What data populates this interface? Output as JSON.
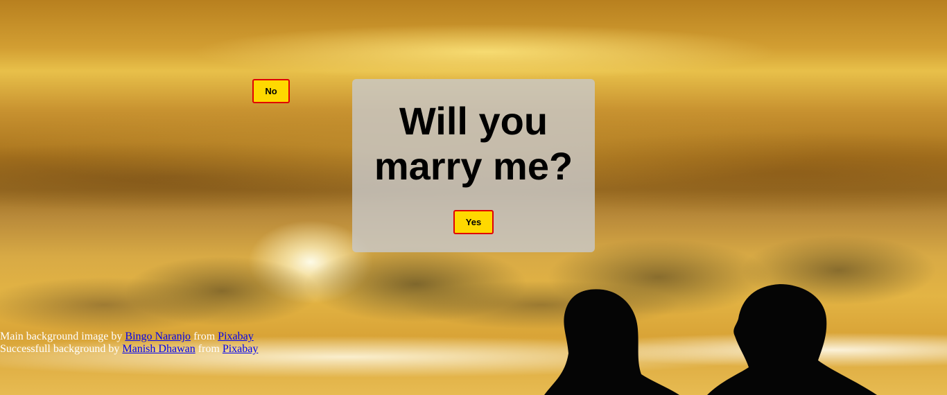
{
  "question": {
    "line1": "Will you",
    "line2": "marry me?"
  },
  "buttons": {
    "yes_label": "Yes",
    "no_label": "No"
  },
  "credits": {
    "line1": {
      "prefix": "Main background image by",
      "author": "Bingo Naranjo",
      "middle": "from",
      "source": "Pixabay"
    },
    "line2": {
      "prefix": "Successfull background by",
      "author": "Manish Dhawan",
      "middle": "from",
      "source": "Pixabay"
    }
  },
  "colors": {
    "button_bg": "#ffd800",
    "button_border": "#e00000",
    "card_bg": "rgba(200,200,200,0.82)",
    "link": "#0000ee"
  }
}
